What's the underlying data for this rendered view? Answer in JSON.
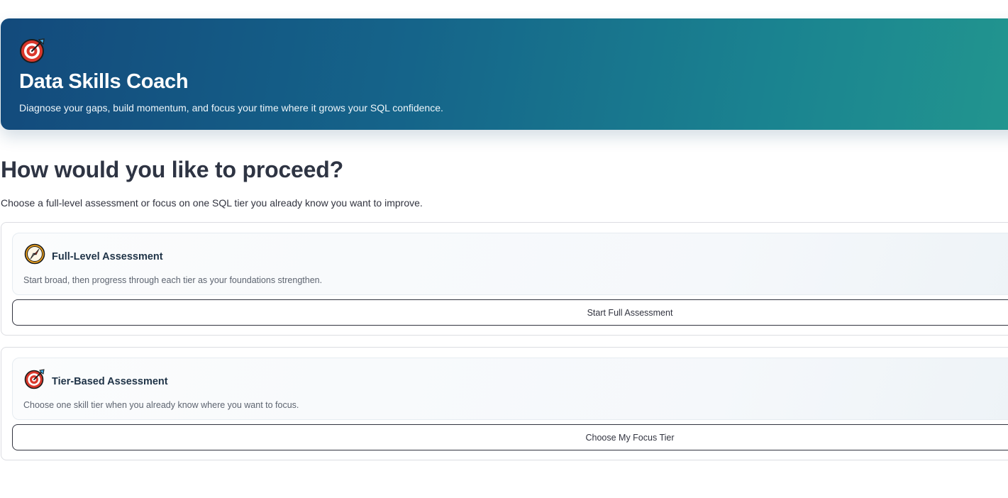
{
  "hero": {
    "icon": "target-icon",
    "title": "Data Skills Coach",
    "subtitle": "Diagnose your gaps, build momentum, and focus your time where it grows your SQL confidence."
  },
  "section": {
    "heading": "How would you like to proceed?",
    "lead": "Choose a full-level assessment or focus on one SQL tier you already know you want to improve."
  },
  "options": [
    {
      "icon": "compass-icon",
      "title": "Full-Level Assessment",
      "description": "Start broad, then progress through each tier as your foundations strengthen.",
      "button_label": "Start Full Assessment"
    },
    {
      "icon": "target-icon",
      "title": "Tier-Based Assessment",
      "description": "Choose one skill tier when you already know where you want to focus.",
      "button_label": "Choose My Focus Tier"
    }
  ],
  "colors": {
    "hero_gradient_start": "#134a7c",
    "hero_gradient_end": "#22968f",
    "heading": "#2e3443",
    "card_title": "#1f3347"
  }
}
